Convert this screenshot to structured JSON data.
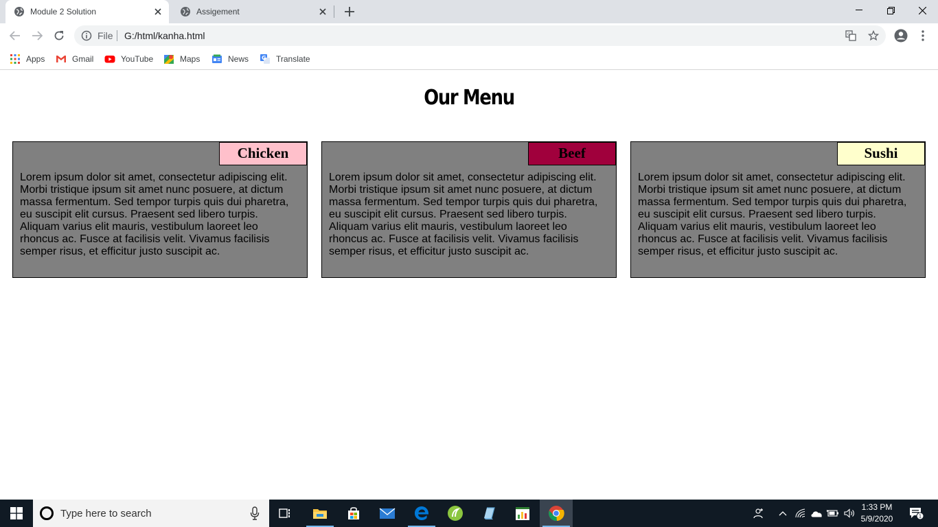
{
  "browser": {
    "tabs": [
      {
        "title": "Module 2 Solution",
        "active": true
      },
      {
        "title": "Assigement",
        "active": false
      }
    ],
    "address": {
      "scheme_label": "File",
      "url": "G:/html/kanha.html"
    },
    "bookmarks": [
      {
        "label": "Apps",
        "icon": "apps-grid-icon"
      },
      {
        "label": "Gmail",
        "icon": "gmail-icon"
      },
      {
        "label": "YouTube",
        "icon": "youtube-icon"
      },
      {
        "label": "Maps",
        "icon": "maps-icon"
      },
      {
        "label": "News",
        "icon": "news-icon"
      },
      {
        "label": "Translate",
        "icon": "translate-icon"
      }
    ]
  },
  "page": {
    "heading": "Our Menu",
    "cards": [
      {
        "title": "Chicken",
        "tag_color": "#ffc0cb",
        "text": "Lorem ipsum dolor sit amet, consectetur adipiscing elit. Morbi tristique ipsum sit amet nunc posuere, at dictum massa fermentum. Sed tempor turpis quis dui pharetra, eu suscipit elit cursus. Praesent sed libero turpis. Aliquam varius elit mauris, vestibulum laoreet leo rhoncus ac. Fusce at facilisis velit. Vivamus facilisis semper risus, et efficitur justo suscipit ac."
      },
      {
        "title": "Beef",
        "tag_color": "#a0003c",
        "text": "Lorem ipsum dolor sit amet, consectetur adipiscing elit. Morbi tristique ipsum sit amet nunc posuere, at dictum massa fermentum. Sed tempor turpis quis dui pharetra, eu suscipit elit cursus. Praesent sed libero turpis. Aliquam varius elit mauris, vestibulum laoreet leo rhoncus ac. Fusce at facilisis velit. Vivamus facilisis semper risus, et efficitur justo suscipit ac."
      },
      {
        "title": "Sushi",
        "tag_color": "#ffffcc",
        "text": "Lorem ipsum dolor sit amet, consectetur adipiscing elit. Morbi tristique ipsum sit amet nunc posuere, at dictum massa fermentum. Sed tempor turpis quis dui pharetra, eu suscipit elit cursus. Praesent sed libero turpis. Aliquam varius elit mauris, vestibulum laoreet leo rhoncus ac. Fusce at facilisis velit. Vivamus facilisis semper risus, et efficitur justo suscipit ac."
      }
    ],
    "card_background": "#808080"
  },
  "taskbar": {
    "search_placeholder": "Type here to search",
    "time": "1:33 PM",
    "date": "5/9/2020",
    "notification_count": "1",
    "pinned_apps": [
      "task-view-icon",
      "file-explorer-icon",
      "store-icon",
      "mail-icon",
      "edge-icon",
      "app-green-icon",
      "app-blue-icon",
      "app-chart-icon",
      "chrome-icon"
    ]
  }
}
